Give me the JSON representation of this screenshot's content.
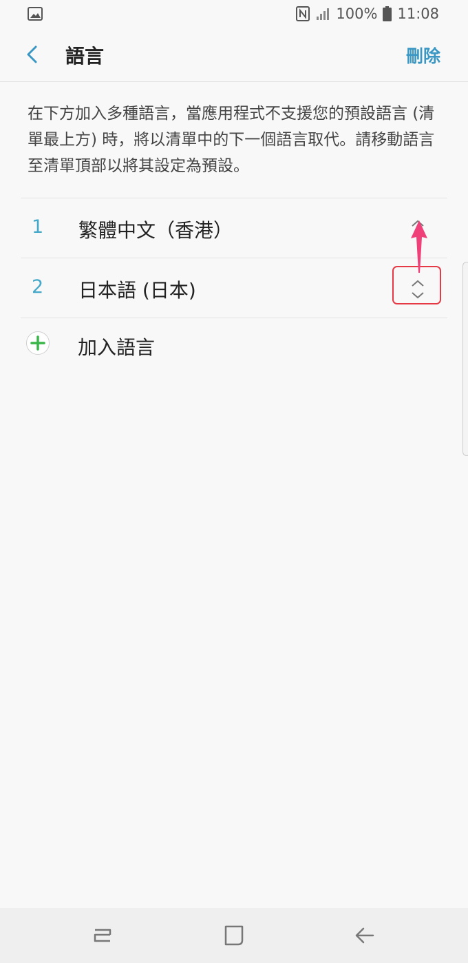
{
  "status_bar": {
    "battery": "100%",
    "time": "11:08",
    "icons": [
      "gallery-icon",
      "nfc-icon",
      "signal-icon",
      "battery-icon"
    ]
  },
  "app_bar": {
    "title": "語言",
    "delete_label": "刪除",
    "accent_color": "#3a97c4"
  },
  "description": "在下方加入多種語言，當應用程式不支援您的預設語言 (清單最上方) 時，將以清單中的下一個語言取代。請移動語言至清單頂部以將其設定為預設。",
  "languages": [
    {
      "number": "1",
      "label": "繁體中文（香港）"
    },
    {
      "number": "2",
      "label": "日本語 (日本)"
    }
  ],
  "add_language_label": "加入語言",
  "annotation": {
    "highlight_color": "#e53a45",
    "arrow_color": "#f0407a"
  },
  "nav_bar": {
    "icons": [
      "recent-apps-icon",
      "home-icon",
      "back-icon"
    ]
  }
}
